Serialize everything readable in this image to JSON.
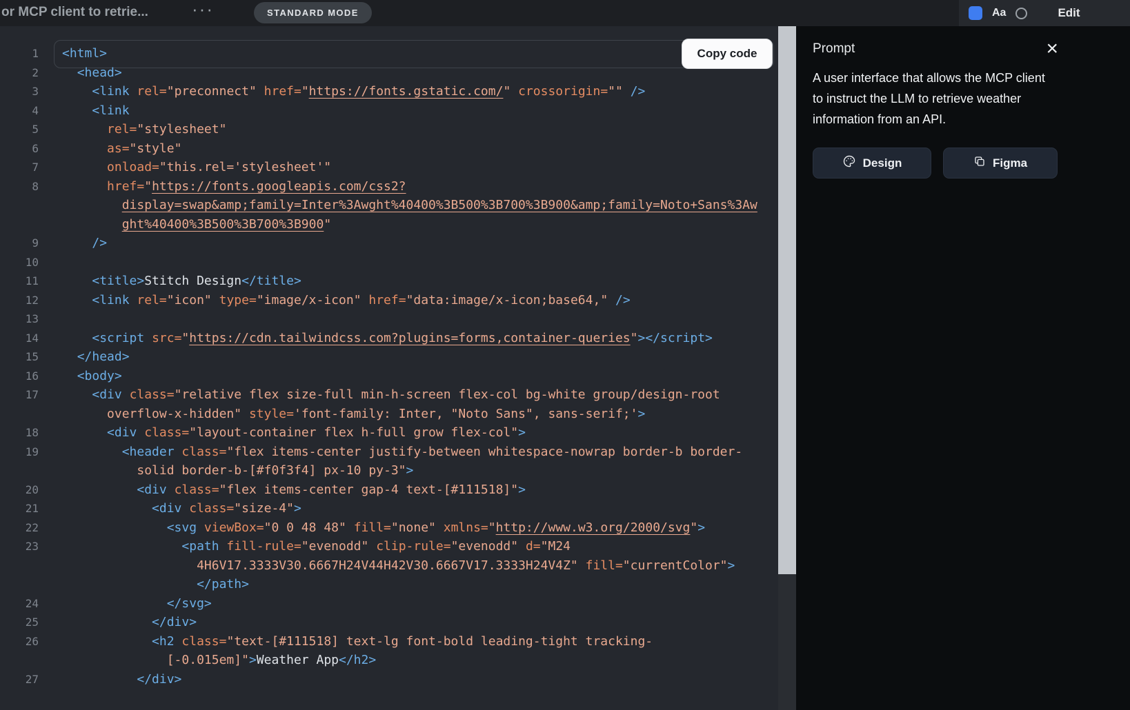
{
  "colors": {
    "accent": "#3f7df0",
    "tok-tag": "#6caee6",
    "tok-attr": "#e58c62",
    "tok-str": "#e9a98f",
    "tok-text": "#dfe3e8"
  },
  "topbar": {
    "title": "or MCP client to retrie...",
    "dots": "···",
    "mode_badge": "STANDARD MODE",
    "aa": "Aa",
    "edit": "Edit"
  },
  "code_panel": {
    "copy_button": "Copy code",
    "rows": [
      {
        "n": "1",
        "s": [
          [
            "t",
            "<html>"
          ]
        ]
      },
      {
        "n": "2",
        "s": [
          [
            "x",
            "  "
          ],
          [
            "t",
            "<head>"
          ]
        ]
      },
      {
        "n": "3",
        "s": [
          [
            "x",
            "    "
          ],
          [
            "t",
            "<link"
          ],
          [
            "x",
            " "
          ],
          [
            "a",
            "rel="
          ],
          [
            "s",
            "\"preconnect\""
          ],
          [
            "x",
            " "
          ],
          [
            "a",
            "href="
          ],
          [
            "s",
            "\""
          ],
          [
            "l",
            "https://fonts.gstatic.com/"
          ],
          [
            "s",
            "\""
          ],
          [
            "x",
            " "
          ],
          [
            "a",
            "crossorigin="
          ],
          [
            "s",
            "\"\""
          ],
          [
            "x",
            " "
          ],
          [
            "t",
            "/>"
          ]
        ]
      },
      {
        "n": "4",
        "s": [
          [
            "x",
            "    "
          ],
          [
            "t",
            "<link"
          ]
        ]
      },
      {
        "n": "5",
        "s": [
          [
            "x",
            "      "
          ],
          [
            "a",
            "rel="
          ],
          [
            "s",
            "\"stylesheet\""
          ]
        ]
      },
      {
        "n": "6",
        "s": [
          [
            "x",
            "      "
          ],
          [
            "a",
            "as="
          ],
          [
            "s",
            "\"style\""
          ]
        ]
      },
      {
        "n": "7",
        "s": [
          [
            "x",
            "      "
          ],
          [
            "a",
            "onload="
          ],
          [
            "s",
            "\"this.rel='stylesheet'\""
          ]
        ]
      },
      {
        "n": "8",
        "s": [
          [
            "x",
            "      "
          ],
          [
            "a",
            "href="
          ],
          [
            "s",
            "\""
          ],
          [
            "l",
            "https://fonts.googleapis.com/css2?"
          ]
        ]
      },
      {
        "n": "",
        "s": [
          [
            "x",
            "        "
          ],
          [
            "l",
            "display=swap&amp;family=Inter%3Awght%40400%3B500%3B700%3B900&amp;family=Noto+Sans%3Aw"
          ]
        ]
      },
      {
        "n": "",
        "s": [
          [
            "x",
            "        "
          ],
          [
            "l",
            "ght%40400%3B500%3B700%3B900"
          ],
          [
            "s",
            "\""
          ]
        ]
      },
      {
        "n": "9",
        "s": [
          [
            "x",
            "    "
          ],
          [
            "t",
            "/>"
          ]
        ]
      },
      {
        "n": "10",
        "s": []
      },
      {
        "n": "11",
        "s": [
          [
            "x",
            "    "
          ],
          [
            "t",
            "<title>"
          ],
          [
            "x",
            "Stitch Design"
          ],
          [
            "t",
            "</title>"
          ]
        ]
      },
      {
        "n": "12",
        "s": [
          [
            "x",
            "    "
          ],
          [
            "t",
            "<link"
          ],
          [
            "x",
            " "
          ],
          [
            "a",
            "rel="
          ],
          [
            "s",
            "\"icon\""
          ],
          [
            "x",
            " "
          ],
          [
            "a",
            "type="
          ],
          [
            "s",
            "\"image/x-icon\""
          ],
          [
            "x",
            " "
          ],
          [
            "a",
            "href="
          ],
          [
            "s",
            "\"data:image/x-icon;base64,\""
          ],
          [
            "x",
            " "
          ],
          [
            "t",
            "/>"
          ]
        ]
      },
      {
        "n": "13",
        "s": []
      },
      {
        "n": "14",
        "s": [
          [
            "x",
            "    "
          ],
          [
            "t",
            "<script"
          ],
          [
            "x",
            " "
          ],
          [
            "a",
            "src="
          ],
          [
            "s",
            "\""
          ],
          [
            "l",
            "https://cdn.tailwindcss.com?plugins=forms,container-queries"
          ],
          [
            "s",
            "\""
          ],
          [
            "t",
            "></script>"
          ]
        ]
      },
      {
        "n": "15",
        "s": [
          [
            "x",
            "  "
          ],
          [
            "t",
            "</head>"
          ]
        ]
      },
      {
        "n": "16",
        "s": [
          [
            "x",
            "  "
          ],
          [
            "t",
            "<body>"
          ]
        ]
      },
      {
        "n": "17",
        "s": [
          [
            "x",
            "    "
          ],
          [
            "t",
            "<div"
          ],
          [
            "x",
            " "
          ],
          [
            "a",
            "class="
          ],
          [
            "s",
            "\"relative flex size-full min-h-screen flex-col bg-white group/design-root"
          ]
        ]
      },
      {
        "n": "",
        "s": [
          [
            "x",
            "      "
          ],
          [
            "s",
            "overflow-x-hidden\""
          ],
          [
            "x",
            " "
          ],
          [
            "a",
            "style="
          ],
          [
            "s",
            "'font-family: Inter, \"Noto Sans\", sans-serif;'"
          ],
          [
            "t",
            ">"
          ]
        ]
      },
      {
        "n": "18",
        "s": [
          [
            "x",
            "      "
          ],
          [
            "t",
            "<div"
          ],
          [
            "x",
            " "
          ],
          [
            "a",
            "class="
          ],
          [
            "s",
            "\"layout-container flex h-full grow flex-col\""
          ],
          [
            "t",
            ">"
          ]
        ]
      },
      {
        "n": "19",
        "s": [
          [
            "x",
            "        "
          ],
          [
            "t",
            "<header"
          ],
          [
            "x",
            " "
          ],
          [
            "a",
            "class="
          ],
          [
            "s",
            "\"flex items-center justify-between whitespace-nowrap border-b border-"
          ]
        ]
      },
      {
        "n": "",
        "s": [
          [
            "x",
            "          "
          ],
          [
            "s",
            "solid border-b-[#f0f3f4] px-10 py-3\""
          ],
          [
            "t",
            ">"
          ]
        ]
      },
      {
        "n": "20",
        "s": [
          [
            "x",
            "          "
          ],
          [
            "t",
            "<div"
          ],
          [
            "x",
            " "
          ],
          [
            "a",
            "class="
          ],
          [
            "s",
            "\"flex items-center gap-4 text-[#111518]\""
          ],
          [
            "t",
            ">"
          ]
        ]
      },
      {
        "n": "21",
        "s": [
          [
            "x",
            "            "
          ],
          [
            "t",
            "<div"
          ],
          [
            "x",
            " "
          ],
          [
            "a",
            "class="
          ],
          [
            "s",
            "\"size-4\""
          ],
          [
            "t",
            ">"
          ]
        ]
      },
      {
        "n": "22",
        "s": [
          [
            "x",
            "              "
          ],
          [
            "t",
            "<svg"
          ],
          [
            "x",
            " "
          ],
          [
            "a",
            "viewBox="
          ],
          [
            "s",
            "\"0 0 48 48\""
          ],
          [
            "x",
            " "
          ],
          [
            "a",
            "fill="
          ],
          [
            "s",
            "\"none\""
          ],
          [
            "x",
            " "
          ],
          [
            "a",
            "xmlns="
          ],
          [
            "s",
            "\""
          ],
          [
            "l",
            "http://www.w3.org/2000/svg"
          ],
          [
            "s",
            "\""
          ],
          [
            "t",
            ">"
          ]
        ]
      },
      {
        "n": "23",
        "s": [
          [
            "x",
            "                "
          ],
          [
            "t",
            "<path"
          ],
          [
            "x",
            " "
          ],
          [
            "a",
            "fill-rule="
          ],
          [
            "s",
            "\"evenodd\""
          ],
          [
            "x",
            " "
          ],
          [
            "a",
            "clip-rule="
          ],
          [
            "s",
            "\"evenodd\""
          ],
          [
            "x",
            " "
          ],
          [
            "a",
            "d="
          ],
          [
            "s",
            "\"M24"
          ]
        ]
      },
      {
        "n": "",
        "s": [
          [
            "x",
            "                  "
          ],
          [
            "s",
            "4H6V17.3333V30.6667H24V44H42V30.6667V17.3333H24V4Z\""
          ],
          [
            "x",
            " "
          ],
          [
            "a",
            "fill="
          ],
          [
            "s",
            "\"currentColor\""
          ],
          [
            "t",
            ">"
          ]
        ]
      },
      {
        "n": "",
        "s": [
          [
            "x",
            "                  "
          ],
          [
            "t",
            "</path>"
          ]
        ]
      },
      {
        "n": "24",
        "s": [
          [
            "x",
            "              "
          ],
          [
            "t",
            "</svg>"
          ]
        ]
      },
      {
        "n": "25",
        "s": [
          [
            "x",
            "            "
          ],
          [
            "t",
            "</div>"
          ]
        ]
      },
      {
        "n": "26",
        "s": [
          [
            "x",
            "            "
          ],
          [
            "t",
            "<h2"
          ],
          [
            "x",
            " "
          ],
          [
            "a",
            "class="
          ],
          [
            "s",
            "\"text-[#111518] text-lg font-bold leading-tight tracking-"
          ]
        ]
      },
      {
        "n": "",
        "s": [
          [
            "x",
            "              "
          ],
          [
            "s",
            "[-0.015em]\""
          ],
          [
            "t",
            ">"
          ],
          [
            "x",
            "Weather App"
          ],
          [
            "t",
            "</h2>"
          ]
        ]
      },
      {
        "n": "27",
        "s": [
          [
            "x",
            "          "
          ],
          [
            "t",
            "</div>"
          ]
        ]
      }
    ]
  },
  "prompt_panel": {
    "title": "Prompt",
    "close": "×",
    "description": "A user interface that allows the MCP client to instruct the LLM to retrieve weather information from an API.",
    "design_button": "Design",
    "figma_button": "Figma"
  }
}
